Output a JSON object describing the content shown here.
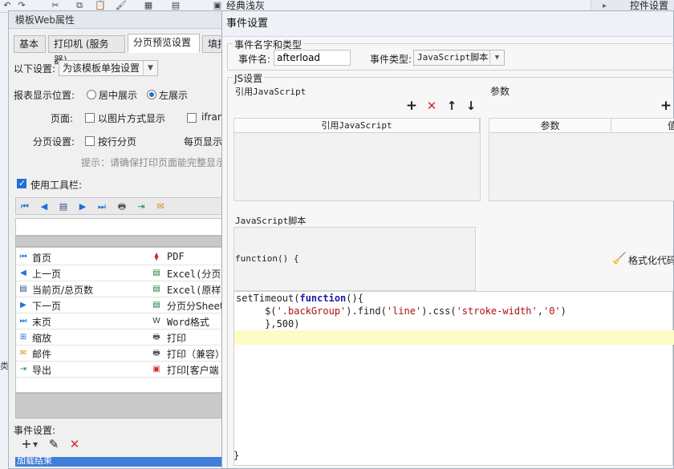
{
  "topbar": {
    "tb_title": "经典浅灰",
    "right_title": "控件设置"
  },
  "left_window": {
    "title": "模板Web属性",
    "tabs": [
      "基本",
      "打印机 (服务器)",
      "分页预览设置",
      "填报"
    ],
    "setting_label": "以下设置:",
    "setting_value": "为该模板单独设置",
    "position_label": "报表显示位置:",
    "pos_center": "居中展示",
    "pos_left": "左展示",
    "page_label": "页面:",
    "image_mode": "以图片方式显示",
    "iframe": "ifram",
    "paging_label": "分页设置:",
    "row_paging": "按行分页",
    "per_page": "每页显示",
    "hint": "提示：请确保打印页面能完整显示",
    "use_toolbar": "使用工具栏:",
    "left_items": [
      "首页",
      "上一页",
      "当前页/总页数",
      "下一页",
      "末页",
      "缩放",
      "邮件",
      "导出"
    ],
    "right_items": [
      "PDF",
      "Excel(分页导",
      "Excel(原样导",
      "分页分Sheet导",
      "Word格式",
      "打印",
      "打印（兼容）",
      "打印[客户端"
    ],
    "event_label": "事件设置:",
    "event_item": "加载结束",
    "side_char": "类"
  },
  "dialog": {
    "title": "事件设置",
    "group_name": "事件名字和类型",
    "event_name_label": "事件名:",
    "event_name_value": "afterload",
    "event_type_label": "事件类型:",
    "event_type_value": "JavaScript脚本",
    "js_group": "JS设置",
    "ref_js_label": "引用JavaScript",
    "params_label": "参数",
    "ref_js_header": "引用JavaScript",
    "params_header": "参数",
    "value_header": "值",
    "script_label": "JavaScript脚本",
    "func_header": "function() {",
    "format_code": "格式化代码",
    "closing": "}",
    "code_lines": {
      "l1_a": "setTimeout(",
      "l1_kw": "function",
      "l1_b": "(){",
      "l2_a": "     $(",
      "l2_s1": "'.backGroup'",
      "l2_b": ").find(",
      "l2_s2": "'line'",
      "l2_c": ").css(",
      "l2_s3": "'stroke-width'",
      "l2_d": ",",
      "l2_s4": "'0'",
      "l2_e": ")",
      "l3": "     },500)"
    }
  },
  "colors": {
    "accent": "#1e6fd9",
    "delete": "#d9262c",
    "highlight": "#fdfbc6",
    "string": "#aa1111",
    "keyword": "#1a1aa6"
  }
}
